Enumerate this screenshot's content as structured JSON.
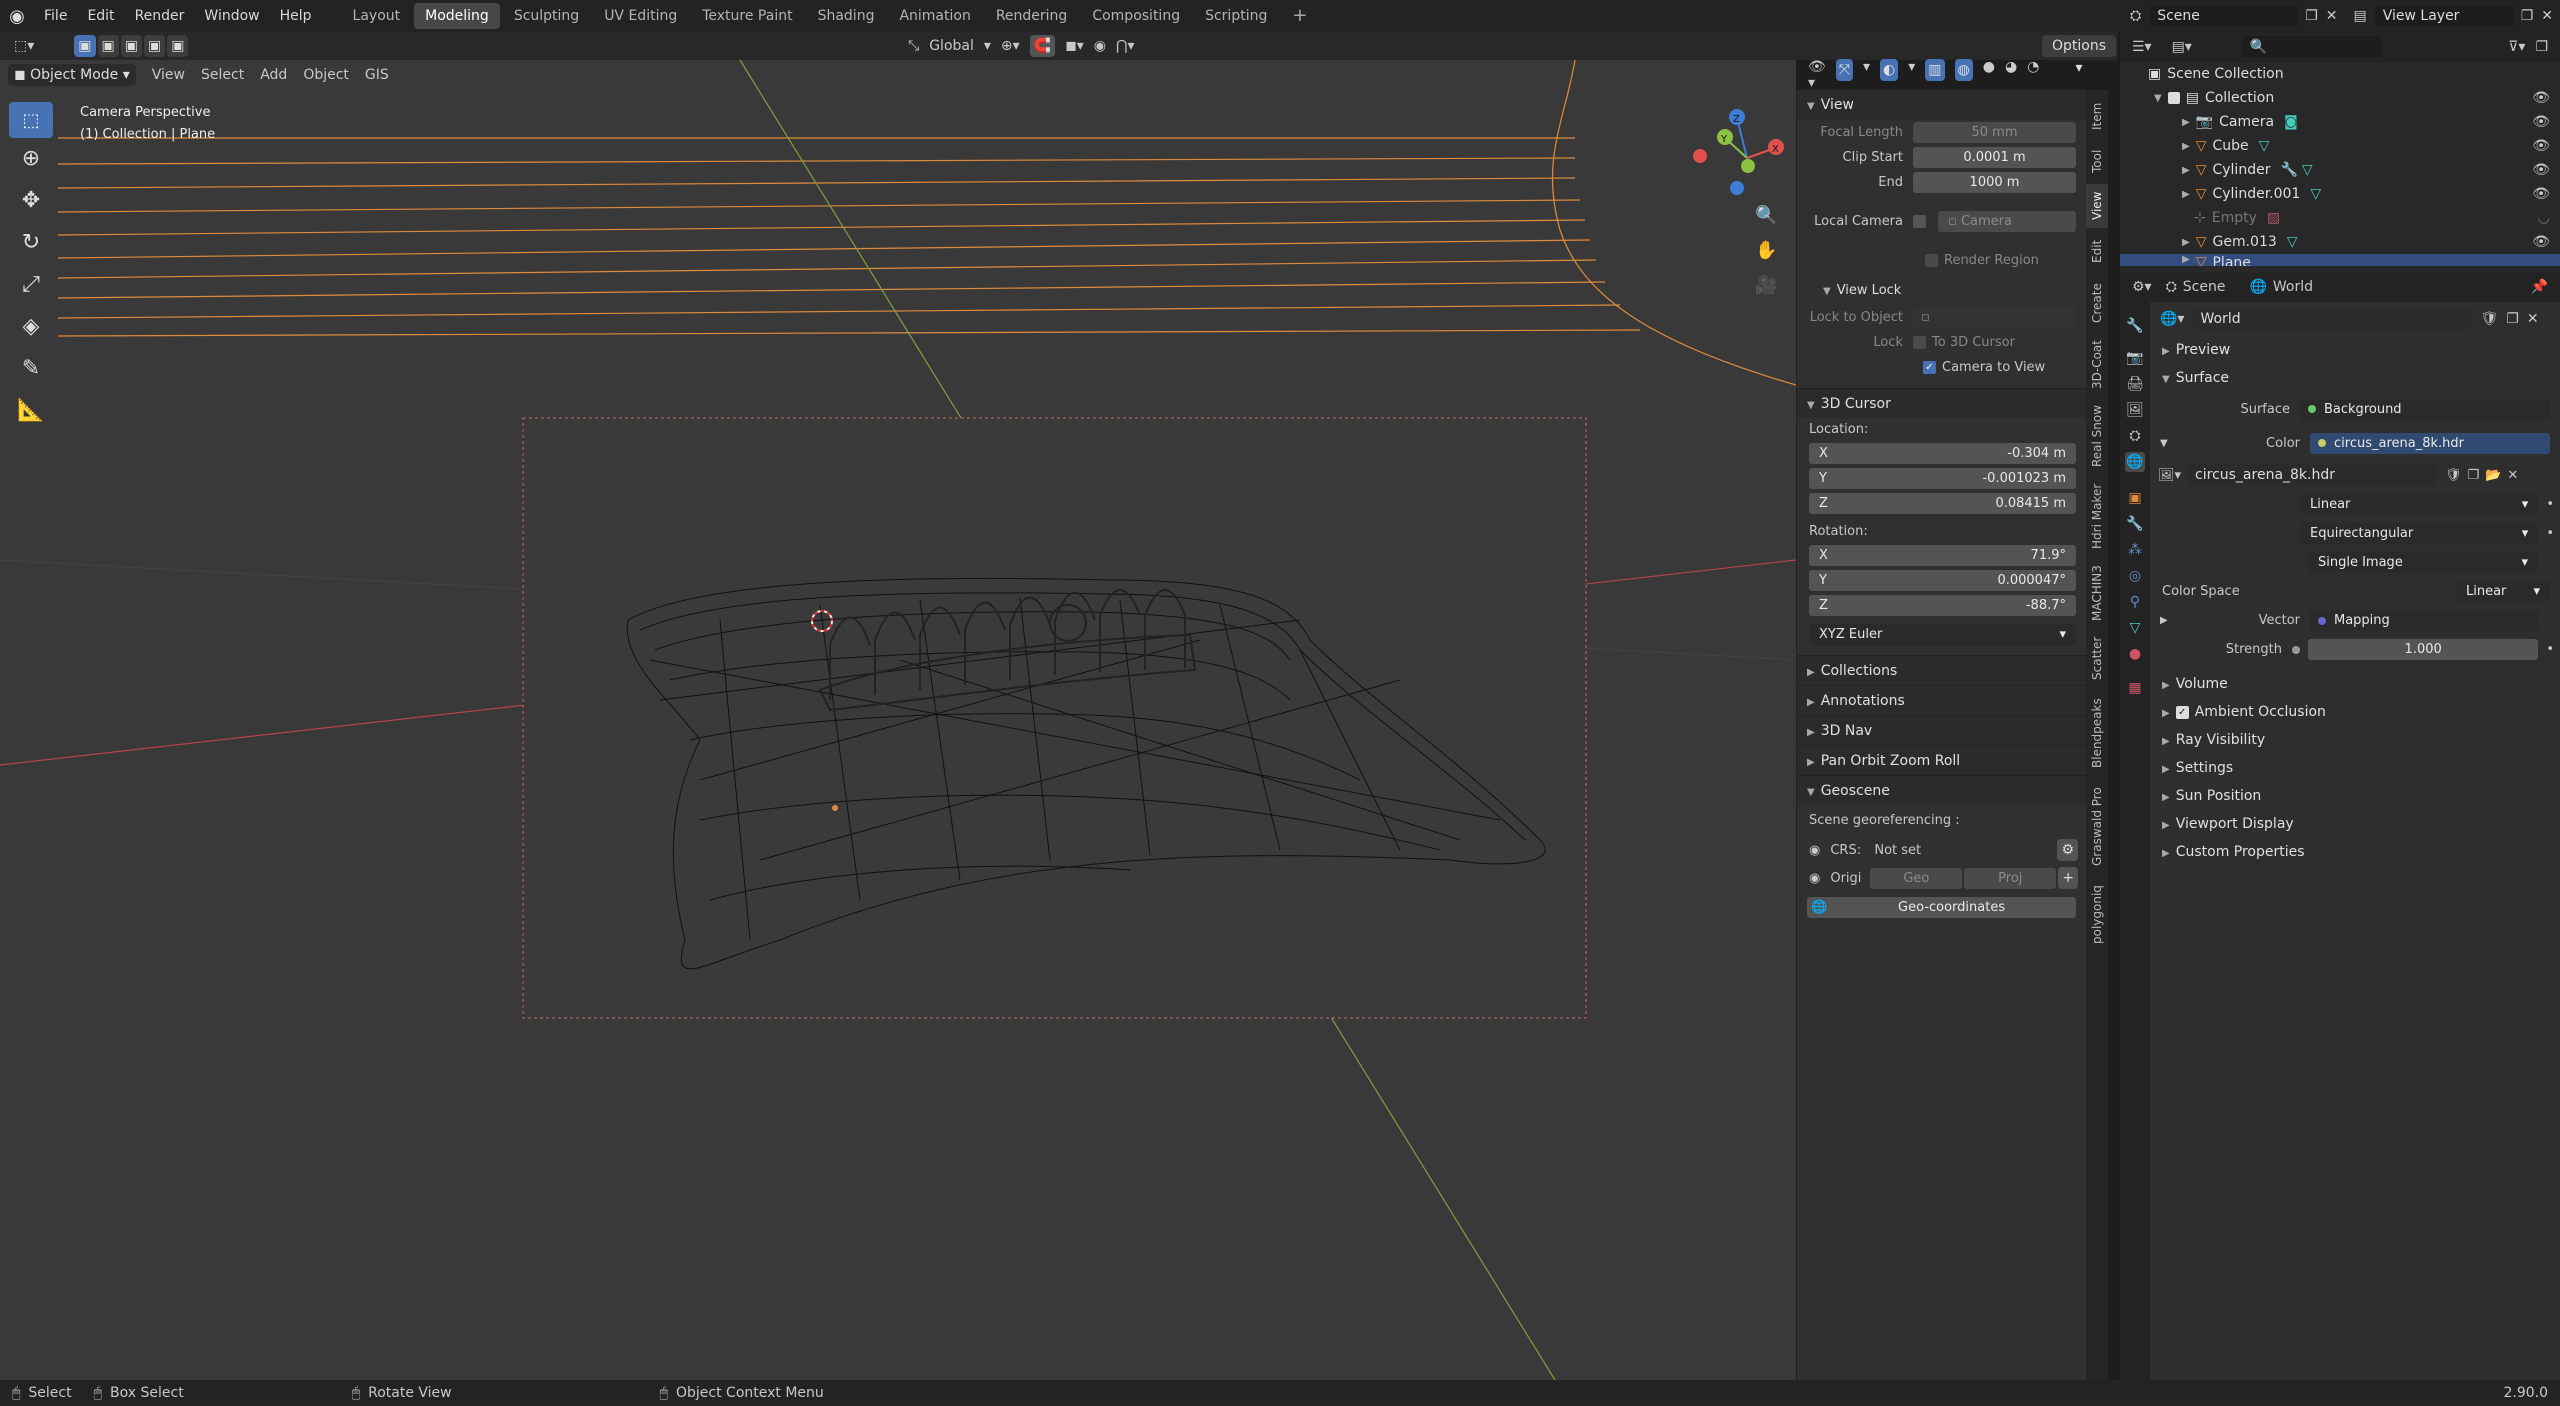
{
  "topbar": {
    "menus": [
      "File",
      "Edit",
      "Render",
      "Window",
      "Help"
    ],
    "workspaces": [
      "Layout",
      "Modeling",
      "Sculpting",
      "UV Editing",
      "Texture Paint",
      "Shading",
      "Animation",
      "Rendering",
      "Compositing",
      "Scripting"
    ],
    "active_workspace": "Modeling",
    "scene": "Scene",
    "view_layer": "View Layer"
  },
  "viewport_header": {
    "mode": "Object Mode",
    "menus": [
      "View",
      "Select",
      "Add",
      "Object",
      "GIS"
    ],
    "transform_orientation": "Global",
    "options": "Options"
  },
  "viewport": {
    "perspective": "Camera Perspective",
    "collection_info": "(1) Collection | Plane",
    "gizmo_axes": [
      "X",
      "Y",
      "Z"
    ]
  },
  "npanel": {
    "view": {
      "title": "View",
      "focal_length_label": "Focal Length",
      "focal_length": "50 mm",
      "clip_start_label": "Clip Start",
      "clip_start": "0.0001 m",
      "end_label": "End",
      "end": "1000 m",
      "local_camera_label": "Local Camera",
      "local_camera": "Camera",
      "render_region": "Render Region",
      "view_lock_title": "View Lock",
      "lock_to_object_label": "Lock to Object",
      "lock_label": "Lock",
      "to_3d_cursor": "To 3D Cursor",
      "camera_to_view": "Camera to View"
    },
    "cursor": {
      "title": "3D Cursor",
      "location_label": "Location:",
      "loc": [
        {
          "axis": "X",
          "value": "-0.304 m"
        },
        {
          "axis": "Y",
          "value": "-0.001023 m"
        },
        {
          "axis": "Z",
          "value": "0.08415 m"
        }
      ],
      "rotation_label": "Rotation:",
      "rot": [
        {
          "axis": "X",
          "value": "71.9°"
        },
        {
          "axis": "Y",
          "value": "0.000047°"
        },
        {
          "axis": "Z",
          "value": "-88.7°"
        }
      ],
      "rotation_mode": "XYZ Euler"
    },
    "collapsed": [
      "Collections",
      "Annotations",
      "3D Nav",
      "Pan Orbit Zoom Roll"
    ],
    "geoscene": {
      "title": "Geoscene",
      "georef_label": "Scene georeferencing :",
      "crs_label": "CRS:",
      "crs_value": "Not set",
      "origin_label": "Origi",
      "geo": "Geo",
      "proj": "Proj",
      "geo_coords": "Geo-coordinates"
    }
  },
  "vertical_tabs": [
    "Item",
    "Tool",
    "View",
    "Edit",
    "Create",
    "3D-Coat",
    "Real Snow",
    "Hdri Maker",
    "MACHIN3",
    "Scatter",
    "Blendpeaks",
    "Graswald Pro",
    "polygoniq"
  ],
  "outliner": {
    "root": "Scene Collection",
    "collection": "Collection",
    "items": [
      "Camera",
      "Cube",
      "Cylinder",
      "Cylinder.001",
      "Empty",
      "Gem.013",
      "Plane"
    ]
  },
  "properties": {
    "breadcrumb_scene": "Scene",
    "breadcrumb_world": "World",
    "world_name": "World",
    "preview": "Preview",
    "surface": "Surface",
    "surface_label": "Surface",
    "surface_value": "Background",
    "color_label": "Color",
    "color_value": "circus_arena_8k.hdr",
    "image_name": "circus_arena_8k.hdr",
    "interpolation": "Linear",
    "projection": "Equirectangular",
    "source": "Single Image",
    "color_space_label": "Color Space",
    "color_space": "Linear",
    "vector_label": "Vector",
    "vector_value": "Mapping",
    "strength_label": "Strength",
    "strength": "1.000",
    "sections": [
      "Volume",
      "Ambient Occlusion",
      "Ray Visibility",
      "Settings",
      "Sun Position",
      "Viewport Display",
      "Custom Properties"
    ]
  },
  "statusbar": {
    "select": "Select",
    "box_select": "Box Select",
    "rotate": "Rotate View",
    "context_menu": "Object Context Menu",
    "version": "2.90.0"
  },
  "colors": {
    "accent": "#4772b3",
    "orange": "#e08b3a",
    "x_axis": "#e2504e",
    "y_axis": "#8ac33f",
    "z_axis": "#3d7fd6"
  }
}
